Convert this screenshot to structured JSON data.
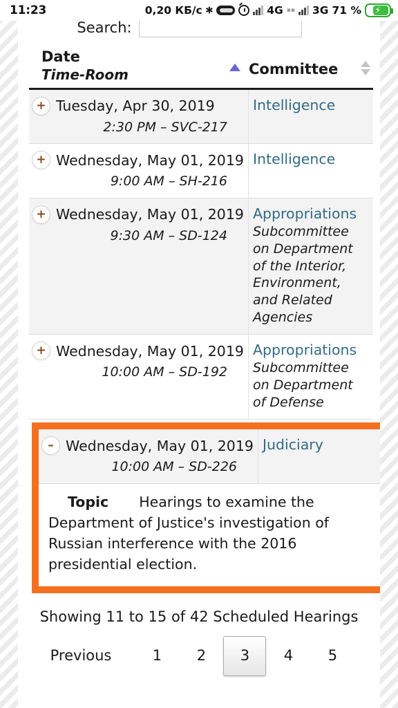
{
  "status_bar": {
    "time": "11:23",
    "data_rate": "0,20 КБ/с",
    "bluetooth_icon": "bluetooth-icon",
    "capsule_icon": "capsule-icon",
    "alarm_icon": "alarm-clock-icon",
    "network_1": "4G",
    "network_2": "3G",
    "battery_percent": "71 %",
    "battery_icon": "battery-charging-icon"
  },
  "search": {
    "label": "Search:",
    "value": "",
    "placeholder": ""
  },
  "table": {
    "headers": {
      "date": "Date",
      "date_sub": "Time-Room",
      "date_sort": "ascending",
      "committee": "Committee",
      "committee_sort": "none"
    },
    "rows": [
      {
        "toggle": "+",
        "date": "Tuesday, Apr 30, 2019",
        "time_room": "2:30 PM – SVC-217",
        "committee": "Intelligence",
        "subcommittee": "",
        "shaded": true,
        "expanded": false
      },
      {
        "toggle": "+",
        "date": "Wednesday, May 01, 2019",
        "time_room": "9:00 AM – SH-216",
        "committee": "Intelligence",
        "subcommittee": "",
        "shaded": false,
        "expanded": false
      },
      {
        "toggle": "+",
        "date": "Wednesday, May 01, 2019",
        "time_room": "9:30 AM – SD-124",
        "committee": "Appropriations",
        "subcommittee": "Subcommittee on Department of the Interior, Environment, and Related Agencies",
        "shaded": true,
        "expanded": false
      },
      {
        "toggle": "+",
        "date": "Wednesday, May 01, 2019",
        "time_room": "10:00 AM – SD-192",
        "committee": "Appropriations",
        "subcommittee": "Subcommittee on Department of Defense",
        "shaded": false,
        "expanded": false
      },
      {
        "toggle": "–",
        "date": "Wednesday, May 01, 2019",
        "time_room": "10:00 AM – SD-226",
        "committee": "Judiciary",
        "subcommittee": "",
        "shaded": true,
        "expanded": true,
        "topic_label": "Topic",
        "topic_text": "Hearings to examine the Department of Justice's investigation of Russian interference with the 2016 presidential election."
      }
    ]
  },
  "footer": {
    "info": "Showing 11 to 15 of 42 Scheduled Hearings",
    "previous_label": "Previous",
    "pages": [
      "1",
      "2",
      "3",
      "4",
      "5"
    ],
    "active_page": "3"
  },
  "colors": {
    "highlight_border": "#f4701f",
    "link": "#336b87",
    "sort_active": "#6a63d4",
    "toggle_glyph": "#8a4b20"
  }
}
